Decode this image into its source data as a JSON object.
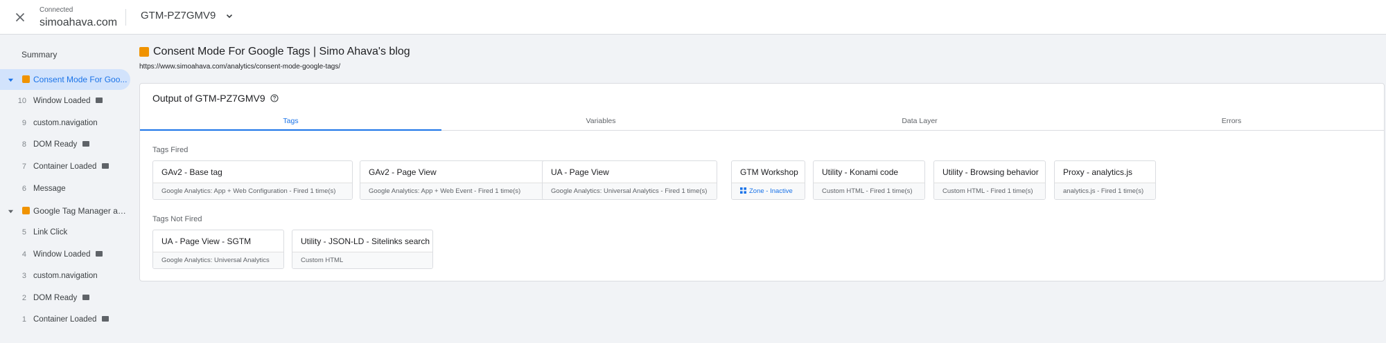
{
  "header": {
    "status": "Connected",
    "site": "simoahava.com",
    "container_id": "GTM-PZ7GMV9"
  },
  "sidebar": {
    "summary": "Summary",
    "pages": [
      {
        "label": "Consent Mode For Goo...",
        "selected": true,
        "events": [
          {
            "num": "10",
            "label": "Window Loaded",
            "dl": true
          },
          {
            "num": "9",
            "label": "custom.navigation",
            "dl": false
          },
          {
            "num": "8",
            "label": "DOM Ready",
            "dl": true
          },
          {
            "num": "7",
            "label": "Container Loaded",
            "dl": true
          },
          {
            "num": "6",
            "label": "Message",
            "dl": false
          }
        ]
      },
      {
        "label": "Google Tag Manager an...",
        "selected": false,
        "events": [
          {
            "num": "5",
            "label": "Link Click",
            "dl": false
          },
          {
            "num": "4",
            "label": "Window Loaded",
            "dl": true
          },
          {
            "num": "3",
            "label": "custom.navigation",
            "dl": false
          },
          {
            "num": "2",
            "label": "DOM Ready",
            "dl": true
          },
          {
            "num": "1",
            "label": "Container Loaded",
            "dl": true
          }
        ]
      }
    ]
  },
  "main": {
    "title": "Consent Mode For Google Tags | Simo Ahava's blog",
    "url": "https://www.simoahava.com/analytics/consent-mode-google-tags/",
    "output_title": "Output of GTM-PZ7GMV9",
    "tabs": [
      "Tags",
      "Variables",
      "Data Layer",
      "Errors"
    ],
    "active_tab": "Tags",
    "fired_label": "Tags Fired",
    "not_fired_label": "Tags Not Fired",
    "tags_fired": [
      {
        "name": "GAv2 - Base tag",
        "desc": "Google Analytics: App + Web Configuration - Fired 1 time(s)"
      },
      {
        "name": "GAv2 - Page View",
        "desc": "Google Analytics: App + Web Event - Fired 1 time(s)"
      },
      {
        "name": "UA - Page View",
        "desc": "Google Analytics: Universal Analytics - Fired 1 time(s)"
      },
      {
        "name": "GTM Workshop",
        "desc": "Zone - Inactive",
        "zone": true
      },
      {
        "name": "Utility - Konami code",
        "desc": "Custom HTML - Fired 1 time(s)"
      },
      {
        "name": "Utility - Browsing behavior",
        "desc": "Custom HTML - Fired 1 time(s)"
      },
      {
        "name": "Proxy - analytics.js",
        "desc": "analytics.js - Fired 1 time(s)"
      }
    ],
    "tags_not_fired": [
      {
        "name": "UA - Page View - SGTM",
        "desc": "Google Analytics: Universal Analytics"
      },
      {
        "name": "Utility - JSON-LD - Sitelinks search",
        "desc": "Custom HTML"
      }
    ]
  },
  "colors": {
    "accent": "#1a73e8",
    "page_icon": "#f09300",
    "selected_bg": "#d2e3fc"
  }
}
